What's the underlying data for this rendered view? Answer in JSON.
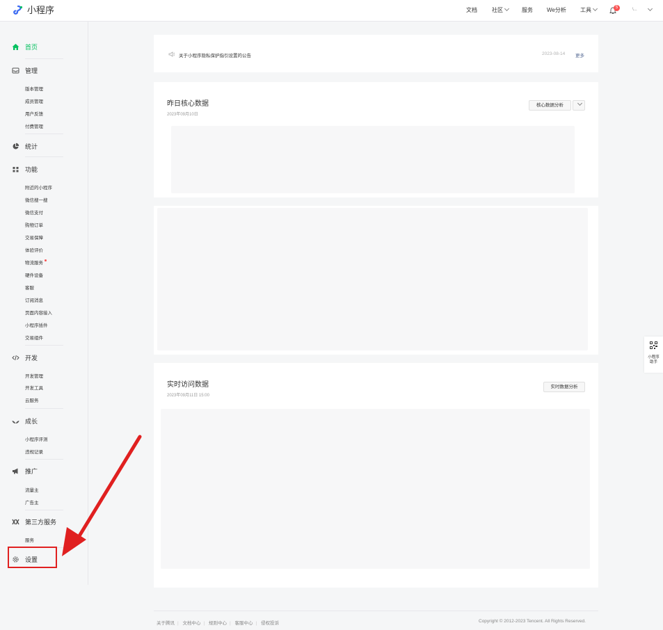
{
  "app": {
    "logo_text": "小程序",
    "logo_icon": "miniprogram-logo-icon",
    "brand_color": "#07c160"
  },
  "topnav": {
    "docs": "文档",
    "community": "社区",
    "service": "服务",
    "we_analysis": "We分析",
    "tools": "工具",
    "notification_count": "5",
    "account": "\\..."
  },
  "sidebar": {
    "home": "首页",
    "manage": {
      "label": "管理",
      "items": [
        "版本管理",
        "成员管理",
        "用户反馈",
        "付费管理"
      ]
    },
    "stats": {
      "label": "统计"
    },
    "features": {
      "label": "功能",
      "items": [
        "附近的小程序",
        "微信搜一搜",
        "微信支付",
        "购物订单",
        "交易保障",
        "体验评价",
        "物流服务",
        "硬件设备",
        "客服",
        "订阅消息",
        "页面内容接入",
        "小程序插件",
        "交易组件"
      ]
    },
    "dev": {
      "label": "开发",
      "items": [
        "开发管理",
        "开发工具",
        "云服务"
      ]
    },
    "growth": {
      "label": "成长",
      "items": [
        "小程序评测",
        "违规记录"
      ]
    },
    "promo": {
      "label": "推广",
      "items": [
        "流量主",
        "广告主"
      ]
    },
    "third_party": {
      "label": "第三方服务",
      "items": [
        "服务"
      ]
    },
    "settings": {
      "label": "设置"
    }
  },
  "notice": {
    "text": "关于小程序隐私保护指引设置的公告",
    "date": "2023-08-14",
    "more": "更多"
  },
  "core_data": {
    "title": "昨日核心数据",
    "date": "2023年09月10日",
    "button": "核心数据分析"
  },
  "realtime": {
    "title": "实时访问数据",
    "datetime": "2023年09月11日 15:00",
    "button": "实时数据分析"
  },
  "footer": {
    "links": [
      "关于腾讯",
      "文档中心",
      "规则中心",
      "客服中心",
      "侵权投诉"
    ],
    "copyright": "Copyright © 2012-2023 Tencent. All Rights Reserved."
  },
  "helper": {
    "label_line1": "小程序",
    "label_line2": "助手"
  },
  "annotation_color": "#e02020"
}
